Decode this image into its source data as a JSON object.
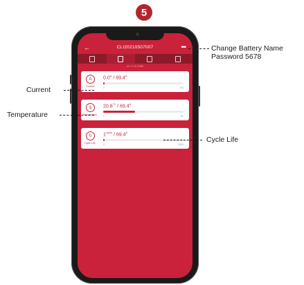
{
  "step": {
    "number": "5"
  },
  "app": {
    "title": "CLI20210507007",
    "subline": "U / I / C / H%",
    "tabs": [
      {
        "icon": "battery-icon",
        "active": false
      },
      {
        "icon": "data-sheet-icon",
        "active": true
      },
      {
        "icon": "alarm-icon",
        "active": false
      },
      {
        "icon": "cart-icon",
        "active": false
      }
    ]
  },
  "cards": [
    {
      "id": "current",
      "icon": "current-icon",
      "glyph": "A",
      "label": "Current",
      "value": "0.0",
      "value_unit": "A",
      "max": "/ 69.4",
      "max_unit": "A",
      "progress": 0.0,
      "scale_min": "0",
      "scale_max": "200"
    },
    {
      "id": "temperature",
      "icon": "thermometer-icon",
      "glyph": "§",
      "label": "Temperature",
      "value": "20.8",
      "value_unit": "°C",
      "max": "/ 69.4",
      "max_unit": "A",
      "progress": 0.4,
      "scale_min": "0",
      "scale_max": "80"
    },
    {
      "id": "cycle-life",
      "icon": "cycle-icon",
      "glyph": "↻",
      "label": "Cycle Life",
      "value": "1",
      "value_unit": "cycle",
      "max": "/ 69.4",
      "max_unit": "A",
      "progress": 0.02,
      "scale_min": "0",
      "scale_max": "3000"
    }
  ],
  "callouts": {
    "change_battery": {
      "line1": "Change Battery Name",
      "line2": "Password 5678"
    },
    "current": "Current",
    "temperature": "Temperature",
    "cycle_life": "Cycle Life"
  },
  "colors": {
    "accent": "#c9223a",
    "badge": "#b3262f",
    "tabbar": "#8c1b2a"
  }
}
